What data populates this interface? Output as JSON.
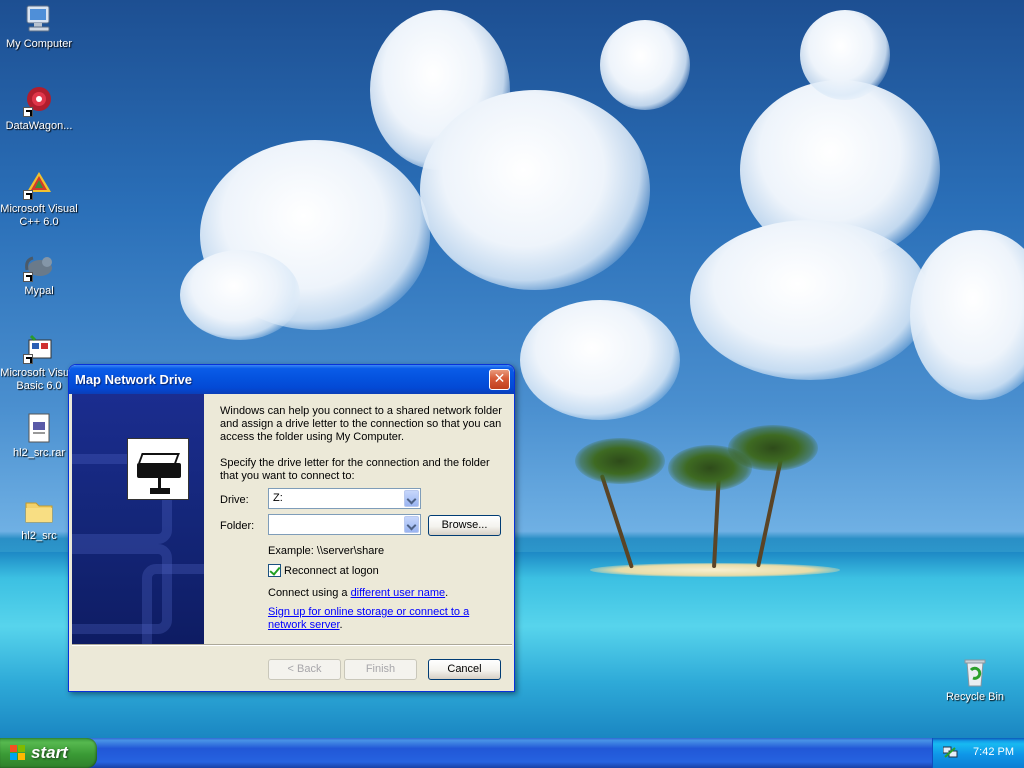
{
  "desktop": {
    "icons": [
      {
        "label": "My Computer",
        "icon": "my-computer-icon"
      },
      {
        "label": "DataWagon...",
        "icon": "datawagon-icon"
      },
      {
        "label": "Microsoft Visual C++ 6.0",
        "icon": "visual-cpp-icon"
      },
      {
        "label": "Mypal",
        "icon": "mypal-icon"
      },
      {
        "label": "Microsoft Visual Basic 6.0",
        "icon": "visual-basic-icon"
      },
      {
        "label": "hl2_src.rar",
        "icon": "archive-file-icon"
      },
      {
        "label": "hl2_src",
        "icon": "folder-icon"
      },
      {
        "label": "Recycle Bin",
        "icon": "recycle-bin-icon"
      }
    ]
  },
  "dialog": {
    "title": "Map Network Drive",
    "close_glyph": "✕",
    "intro": "Windows can help you connect to a shared network folder and assign a drive letter to the connection so that you can access the folder using My Computer.",
    "specify": "Specify the drive letter for the connection and the folder that you want to connect to:",
    "drive_label": "Drive:",
    "drive_value": "Z:",
    "folder_label": "Folder:",
    "folder_value": "",
    "browse_label": "Browse...",
    "example": "Example: \\\\server\\share",
    "reconnect_label": "Reconnect at logon",
    "reconnect_checked": true,
    "connect_prefix": "Connect using a ",
    "connect_link": "different user name",
    "connect_suffix": ".",
    "signup_link": "Sign up for online storage or connect to a network server",
    "signup_suffix": ".",
    "back_label": "< Back",
    "finish_label": "Finish",
    "cancel_label": "Cancel"
  },
  "taskbar": {
    "start_label": "start",
    "clock": "7:42 PM",
    "tray_icon": "network-icon"
  }
}
